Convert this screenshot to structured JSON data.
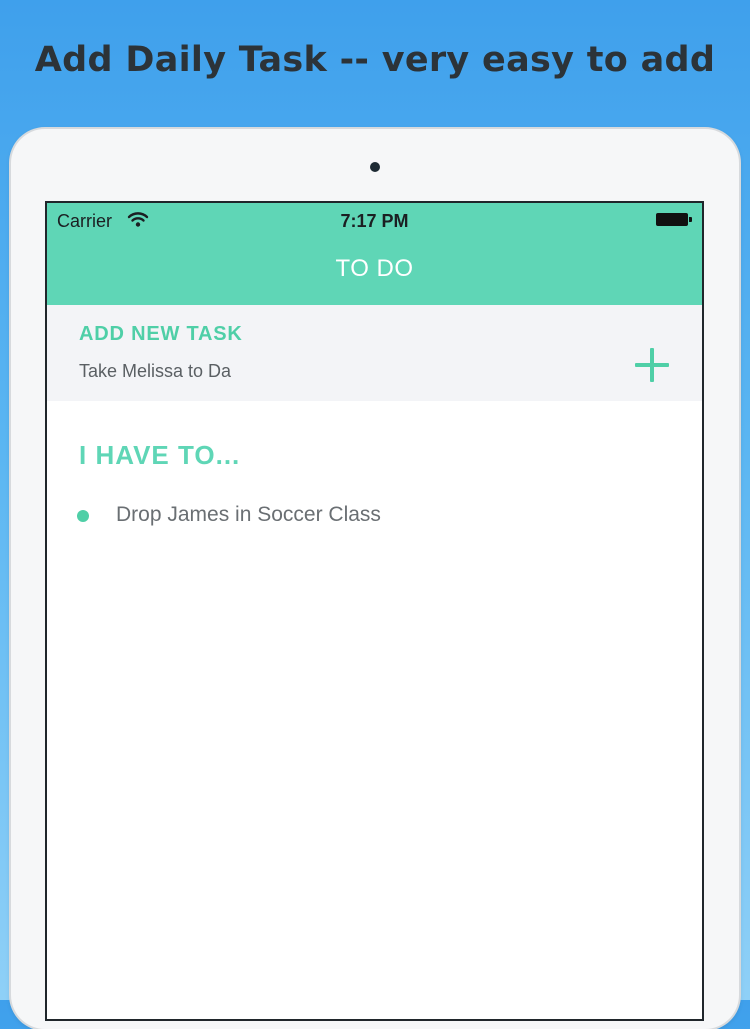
{
  "promo": {
    "title": "Add Daily Task -- very easy to add"
  },
  "status_bar": {
    "carrier": "Carrier",
    "time": "7:17 PM",
    "wifi_icon": "wifi-icon",
    "battery_icon": "battery-icon"
  },
  "nav": {
    "title": "TO DO"
  },
  "add_task": {
    "label": "ADD NEW TASK",
    "input_value": "Take Melissa to Da",
    "add_icon": "plus-icon"
  },
  "list": {
    "heading": "I HAVE TO...",
    "items": [
      {
        "label": "Drop James in Soccer Class"
      }
    ]
  },
  "colors": {
    "accent": "#5fd6b6",
    "accent_dark": "#4fcfa7",
    "background_gradient_top": "#3fa0ec",
    "background_gradient_bottom": "#8fd0f7",
    "title_text": "#2c3338"
  }
}
